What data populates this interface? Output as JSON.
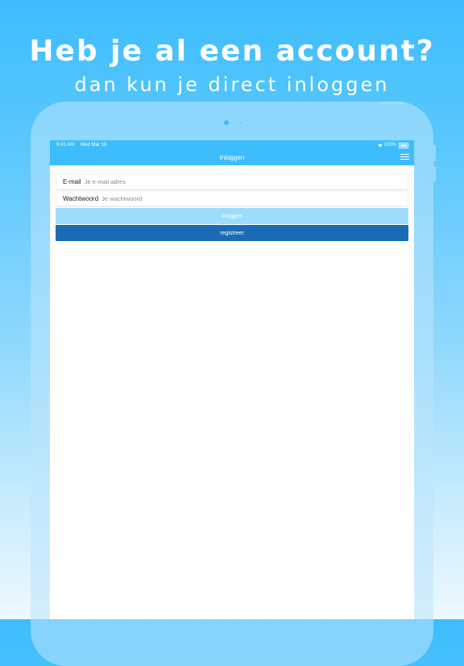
{
  "promo": {
    "headline": "Heb je al een account?",
    "subline": "dan kun je direct inloggen"
  },
  "statusbar": {
    "time": "9:41 AM",
    "date": "Wed Mar 18",
    "battery": "100%",
    "wifi_icon": "wifi-icon",
    "battery_icon": "battery-icon"
  },
  "navbar": {
    "title": "Inloggen",
    "menu_icon": "hamburger-menu-icon"
  },
  "form": {
    "email_label": "E-mail",
    "email_placeholder": "Je e-mail adres",
    "password_label": "Wachtwoord",
    "password_placeholder": "Je wachtwoord",
    "login_label": "inloggen",
    "register_label": "registreer"
  },
  "colors": {
    "accent": "#3dbdfd",
    "login_button": "#9ddcfb",
    "register_button": "#1a6bb6"
  }
}
